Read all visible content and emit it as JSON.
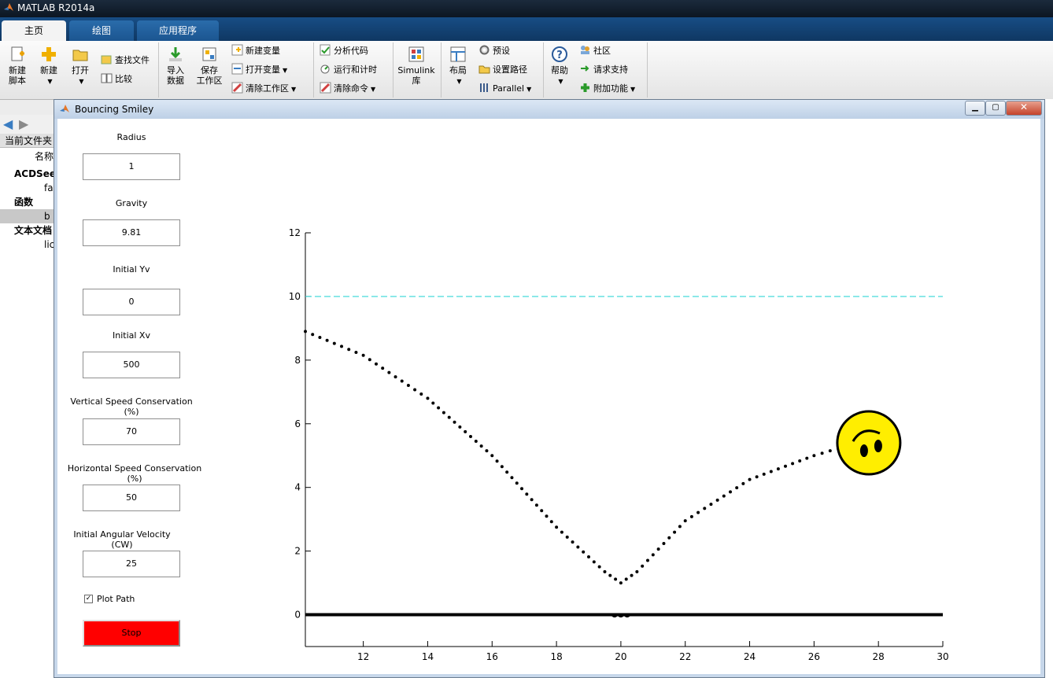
{
  "app": {
    "title": "MATLAB R2014a"
  },
  "tabs": [
    {
      "label": "主页"
    },
    {
      "label": "绘图"
    },
    {
      "label": "应用程序"
    }
  ],
  "ribbon": {
    "new_script": "新建\n脚本",
    "new": "新建",
    "open": "打开",
    "find_files": "查找文件",
    "compare": "比较",
    "import_data": "导入\n数据",
    "save_workspace": "保存\n工作区",
    "new_variable": "新建变量",
    "open_variable": "打开变量",
    "clear_workspace": "清除工作区",
    "analyze_code": "分析代码",
    "run_and_time": "运行和计时",
    "clear_commands": "清除命令",
    "simulink": "Simulink\n库",
    "layout": "布局",
    "preferences": "预设",
    "set_path": "设置路径",
    "parallel": "Parallel",
    "help": "帮助",
    "community": "社区",
    "request_support": "请求支持",
    "add_ons": "附加功能"
  },
  "background": {
    "current_folder": "当前文件夹",
    "name_header": "名称",
    "tree": [
      "ACDSee",
      "fa",
      "函数",
      "b",
      "文本文档",
      "lic"
    ]
  },
  "figure": {
    "title": "Bouncing Smiley",
    "controls": {
      "radius": {
        "label": "Radius",
        "value": "1"
      },
      "gravity": {
        "label": "Gravity",
        "value": "9.81"
      },
      "initial_yv": {
        "label": "Initial Yv",
        "value": "0"
      },
      "initial_xv": {
        "label": "Initial Xv",
        "value": "500"
      },
      "vertical_speed": {
        "label": "Vertical Speed Conservation (%)",
        "value": "70"
      },
      "horizontal_speed": {
        "label": "Horizontal Speed Conservation (%)",
        "value": "50"
      },
      "angular_velocity": {
        "label": "Initial Angular Velocity (CW)",
        "value": "25"
      },
      "plot_path": {
        "label": "Plot Path",
        "checked": true
      },
      "stop_label": "Stop"
    }
  },
  "chart_data": {
    "type": "line",
    "title": "",
    "xlabel": "",
    "ylabel": "",
    "xlim": [
      10.2,
      30
    ],
    "ylim": [
      -1,
      12
    ],
    "xticks": [
      12,
      14,
      16,
      18,
      20,
      22,
      24,
      26,
      28,
      30
    ],
    "yticks": [
      0,
      2,
      4,
      6,
      8,
      10,
      12
    ],
    "grid": false,
    "ceiling": {
      "y": 10,
      "style": "dashed",
      "color": "#33d6d6"
    },
    "floor": {
      "y": 0,
      "color": "#000000"
    },
    "path": {
      "style": "dotted",
      "color": "#000000",
      "points": [
        [
          10.2,
          8.9
        ],
        [
          12,
          8.15
        ],
        [
          14,
          6.8
        ],
        [
          16,
          5.0
        ],
        [
          18,
          2.75
        ],
        [
          19.5,
          1.35
        ],
        [
          20,
          1.0
        ],
        [
          20.5,
          1.35
        ],
        [
          22,
          2.95
        ],
        [
          24,
          4.25
        ],
        [
          26,
          5.0
        ],
        [
          27,
          5.3
        ],
        [
          27.5,
          5.35
        ]
      ]
    },
    "smiley": {
      "center": [
        27.7,
        5.4
      ],
      "color": "#ffee00",
      "outline": "#000000"
    }
  }
}
